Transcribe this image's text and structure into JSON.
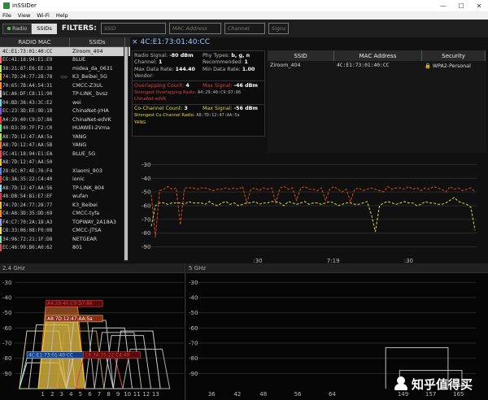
{
  "window": {
    "title": "inSSIDer",
    "controls": [
      "—",
      "☐",
      "✕"
    ]
  },
  "menu": [
    "File",
    "View",
    "Wi-Fi",
    "Help"
  ],
  "filterbar": {
    "radio_label": "Radio",
    "ssids_label": "SSIDs",
    "filters_label": "FILTERS:",
    "ssid_placeholder": "SSID",
    "mac_placeholder": "MAC Address",
    "channel_placeholder": "Channel",
    "signal_placeholder": "Signal"
  },
  "list": {
    "col_mac": "RADIO MAC",
    "col_ssid": "SSIDs",
    "rows": [
      {
        "mac": "4C:E1:73:01:40:CC",
        "ssid": "Ziroom_404",
        "color": "#cfcfcf",
        "selected": true
      },
      {
        "mac": "EC:41:18:94:E1:E9",
        "ssid": "BLUE",
        "color": "#ff6a6a"
      },
      {
        "mac": "38:21:87:E6:EE:38",
        "ssid": "midea_da_0631",
        "color": "#b6e36a"
      },
      {
        "mac": "74:7D:24:77:28:78",
        "ssid": "K3_Beibei_5G",
        "color": "#e0c040",
        "extra": "◇◇"
      },
      {
        "mac": "70:65:7B:A4:54:31",
        "ssid": "CMCC-Z3UL",
        "color": "#ff8a3a"
      },
      {
        "mac": "8C:A6:DF:C8:11:90",
        "ssid": "TP-LINK_ bvsz",
        "color": "#c8c8c8"
      },
      {
        "mac": "04:BD:38:43:3C:E2",
        "ssid": "wei",
        "color": "#7ad1e8"
      },
      {
        "mac": "EC:23:3D:EE:9D:18",
        "ssid": "ChinaNet-jrHA",
        "color": "#7a5ac8"
      },
      {
        "mac": "A4:29:40:C9:D7:86",
        "ssid": "ChinaNet-edVK",
        "color": "#e04040"
      },
      {
        "mac": "40:D3:39:7F:F2:C0",
        "ssid": "HUAWEI-2Vma",
        "color": "#7fe080"
      },
      {
        "mac": "A8:7D:12:47:AA:5a",
        "ssid": "YANG",
        "color": "#b0e050"
      },
      {
        "mac": "A8:7D:12:47:AA:5B",
        "ssid": "YANG",
        "color": "#e08040"
      },
      {
        "mac": "EC:41:18:94:E1:EA",
        "ssid": "BLUE_5G",
        "color": "#e05050"
      },
      {
        "mac": "A8:7D:12:47:AA:50",
        "ssid": "",
        "color": "#e8c050"
      },
      {
        "mac": "28:6C:07:4E:76:F4",
        "ssid": "Xiaomi_903",
        "color": "#5a8ae0"
      },
      {
        "mac": "C8:3A:35:22:C4:40",
        "ssid": "ionic",
        "color": "#e04040"
      },
      {
        "mac": "A8:7D:12:47:AA:56",
        "ssid": "TP-LINK_804",
        "color": "#90d8e8"
      },
      {
        "mac": "48:DB:54:B1:E7:EF",
        "ssid": "wufan",
        "color": "#d04040"
      },
      {
        "mac": "74:7D:24:77:28:77",
        "ssid": "K3_Beibei",
        "color": "#e0c040"
      },
      {
        "mac": "C4:A8:3D:35:DD:69",
        "ssid": "CMCC-tyfa",
        "color": "#ee8a3a"
      },
      {
        "mac": "F4:C7:70:2A:18:A3",
        "ssid": "TOPWAY_2A18A3",
        "color": "#a0a0e8"
      },
      {
        "mac": "C8:33:06:08:F0:08",
        "ssid": "CMCC-JTSA",
        "color": "#e8e070"
      },
      {
        "mac": "34:96:72:21:1F:D8",
        "ssid": "NETGEAR",
        "color": "#7ae0a0"
      },
      {
        "mac": "EC:46:99:B6:A0:62",
        "ssid": "801",
        "color": "#d05050"
      }
    ]
  },
  "detail": {
    "mac": "4C:E1:73:01:40:CC",
    "close": "×",
    "signal_label": "Radio Signal:",
    "signal_value": "-80 dBm",
    "phy_label": "Phy Types:",
    "phy_value": "b, g, n",
    "channel_label": "Channel:",
    "channel_value": "1",
    "recommended_label": "Recommended:",
    "recommended_value": "1",
    "maxrate_label": "Max Data Rate:",
    "maxrate_value": "144.40",
    "minrate_label": "Min Data Rate:",
    "minrate_value": "1.00",
    "vendor_label": "Vendor:",
    "overlap_label": "Overlapping Count:",
    "overlap_value": "4",
    "overlap_max_label": "Max Signal:",
    "overlap_max_value": "-46 dBm",
    "overlap_strongest_label": "Strongest Overlapping Radio:",
    "overlap_strongest_mac": "A4:29:40:C9:D7:86",
    "overlap_ssid": "ChinaNet-edVK",
    "cochan_label": "Co-Channel Count:",
    "cochan_value": "3",
    "cochan_max_label": "Max Signal:",
    "cochan_max_value": "-56 dBm",
    "cochan_strongest_label": "Strongest Co-Channel Radio:",
    "cochan_strongest_mac": "A8:7D:12:47:AA:5a",
    "cochan_ssid": "YANG"
  },
  "ssid_table": {
    "headers": [
      "SSID",
      "MAC Address",
      "Security"
    ],
    "rows": [
      {
        "ssid": "Ziroom_404",
        "mac": "4C:E1:73:01:40:CC",
        "security": "WPA2-Personal"
      }
    ],
    "lock_icon": "lock-icon"
  },
  "chart_data": [
    {
      "type": "line",
      "title": "",
      "ylabel": "",
      "ylim": [
        -95,
        -25
      ],
      "y_ticks": [
        -30,
        -40,
        -50,
        -60,
        -70,
        -80,
        -90
      ],
      "x_ticks": [
        ":30",
        "7:19",
        ":30"
      ],
      "series": [
        {
          "color": "#e04a2a",
          "values": [
            -52,
            -83,
            -49,
            -48,
            -46,
            -48,
            -47,
            -74,
            -47,
            -47,
            -47,
            -48,
            -47,
            -47,
            -48,
            -49,
            -48,
            -48,
            -47,
            -48,
            -47,
            -48,
            -46,
            -58,
            -48,
            -47,
            -49,
            -47,
            -48,
            -47,
            -58,
            -47,
            -46,
            -48,
            -47,
            -56,
            -47,
            -46,
            -48,
            -48,
            -49,
            -47,
            -56,
            -48,
            -46,
            -48,
            -50,
            -48,
            -57,
            -48,
            -47,
            -49,
            -48,
            -47,
            -48,
            -49,
            -50,
            -46,
            -48,
            -47,
            -47,
            -48,
            -46,
            -48,
            -47,
            -49,
            -47,
            -48,
            -46,
            -47,
            -48,
            -50,
            -46,
            -48,
            -47,
            -49,
            -48,
            -47,
            -50
          ]
        },
        {
          "color": "#dada50",
          "values": [
            -75,
            -60,
            -58,
            -58,
            -59,
            -58,
            -58,
            -58,
            -59,
            -57,
            -58,
            -58,
            -58,
            -59,
            -57,
            -59,
            -60,
            -58,
            -57,
            -59,
            -58,
            -60,
            -59,
            -58,
            -58,
            -57,
            -59,
            -58,
            -58,
            -57,
            -57,
            -58,
            -60,
            -57,
            -58,
            -59,
            -58,
            -57,
            -59,
            -58,
            -58,
            -59,
            -58,
            -57,
            -58,
            -60,
            -59,
            -58,
            -58,
            -59,
            -59,
            -58,
            -57,
            -66,
            -79,
            -60,
            -58,
            -57,
            -58,
            -59,
            -58,
            -57,
            -58,
            -58,
            -60,
            -59,
            -57,
            -58,
            -58,
            -59,
            -59,
            -58,
            -56,
            -54,
            -57,
            -58,
            -59,
            -61,
            -78
          ]
        }
      ]
    },
    {
      "type": "area",
      "title": "2.4 GHz",
      "ylim": [
        -100,
        -25
      ],
      "y_ticks": [
        -30,
        -40,
        -50,
        -60,
        -70,
        -80,
        -90
      ],
      "x_ticks": [
        "1",
        "2",
        "3",
        "4",
        "5",
        "6",
        "7",
        "8",
        "9",
        "10",
        "11",
        "12",
        "13"
      ],
      "xlim": [
        -2,
        16
      ],
      "labels": [
        {
          "text": "A4:29:40:C9:D7:86",
          "channel": 3,
          "signal": -46,
          "color": "#e04040"
        },
        {
          "text": "A8:7D:12:47:AA:5a",
          "channel": 3,
          "signal": -56,
          "color": "#ddd84a"
        },
        {
          "text": "4C:E1:73:01:40:CC",
          "channel": 1,
          "signal": -80,
          "color": "#9ad8f0"
        },
        {
          "text": "C8:3A:35:22:C4:40",
          "channel": 7,
          "signal": -80,
          "color": "#e04040"
        }
      ],
      "networks": [
        {
          "channel": 1,
          "signal": -83,
          "color": "#d0d0d0",
          "fill": false
        },
        {
          "channel": 1,
          "signal": -80,
          "color": "#9ad8f0",
          "fill": false
        },
        {
          "channel": 1,
          "signal": -62,
          "color": "#d8d0a0",
          "fill": false
        },
        {
          "channel": 2,
          "signal": -58,
          "color": "#c8c8c8",
          "fill": false
        },
        {
          "channel": 3,
          "signal": -46,
          "color": "#e07030",
          "fill": true
        },
        {
          "channel": 3,
          "signal": -56,
          "color": "#ddd84a",
          "fill": true
        },
        {
          "channel": 4,
          "signal": -52,
          "color": "#b8b8b8",
          "fill": false
        },
        {
          "channel": 5,
          "signal": -62,
          "color": "#c8a040",
          "fill": false
        },
        {
          "channel": 6,
          "signal": -55,
          "color": "#c0c0c0",
          "fill": false
        },
        {
          "channel": 6,
          "signal": -78,
          "color": "#cfcfcf",
          "fill": false
        },
        {
          "channel": 7,
          "signal": -80,
          "color": "#e04040",
          "fill": false
        },
        {
          "channel": 8,
          "signal": -60,
          "color": "#c8c8c8",
          "fill": false
        },
        {
          "channel": 9,
          "signal": -63,
          "color": "#bbbbbb",
          "fill": false
        },
        {
          "channel": 10,
          "signal": -65,
          "color": "#c0c0c0",
          "fill": false
        },
        {
          "channel": 11,
          "signal": -62,
          "color": "#cfcfcf",
          "fill": false
        },
        {
          "channel": 12,
          "signal": -74,
          "color": "#b0b0b0",
          "fill": false
        }
      ]
    },
    {
      "type": "area",
      "title": "5 GHz",
      "ylim": [
        -100,
        -25
      ],
      "y_ticks": [
        -30,
        -40,
        -50,
        -60,
        -70,
        -80,
        -90
      ],
      "x_ticks": [
        "36",
        "42",
        "48",
        "56",
        "64",
        "149",
        "157",
        "165"
      ],
      "x_tick_channels": [
        36,
        42,
        48,
        56,
        64,
        149,
        157,
        165
      ],
      "networks": [
        {
          "channel": 153,
          "signal": -73,
          "color": "#bcbcbc"
        },
        {
          "channel": 157,
          "signal": -88,
          "color": "#bcbcbc"
        }
      ]
    }
  ],
  "watermark": {
    "text": "知乎值得买"
  }
}
